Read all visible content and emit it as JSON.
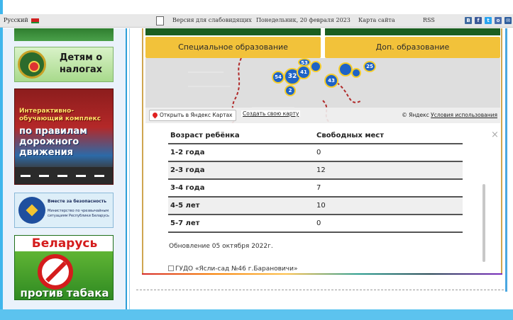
{
  "topbar": {
    "lang": "Русский",
    "low_vision": "Версия для слабовидящих",
    "date": "Понедельник, 20 февраля 2023",
    "sitemap": "Карта сайта",
    "rss": "RSS",
    "social": [
      {
        "icon": "vk-icon",
        "glyph": "B",
        "color": "#3f6aa0"
      },
      {
        "icon": "facebook-icon",
        "glyph": "f",
        "color": "#3b5998"
      },
      {
        "icon": "twitter-icon",
        "glyph": "t",
        "color": "#2aa3ef"
      },
      {
        "icon": "odnoklassniki-icon",
        "glyph": "o",
        "color": "#4a6fb0"
      },
      {
        "icon": "youtube-icon",
        "glyph": "✉",
        "color": "#2f5f9e"
      }
    ]
  },
  "sidebar": {
    "tax_banner": "Детям о налогах",
    "pdd_banner_line1": "Интерактивно-обучающий комплекс",
    "pdd_banner_line2": "по правилам дорожного движения",
    "safety_banner_line1": "Вместе за безопасность",
    "safety_banner_line2": "Министерство по чрезвычайным ситуациям Республики Беларусь",
    "tobacco_banner_line1": "Беларусь",
    "tobacco_banner_line2": "против табака"
  },
  "nav_buttons": {
    "special_education": "Специальное образование",
    "additional_education": "Доп. образование"
  },
  "map": {
    "open_in_yandex": "Открыть в Яндекс Картах",
    "create_map": "Создать свою карту",
    "copyright_prefix": "© Яндекс",
    "terms": "Условия использования",
    "clusters": [
      {
        "label": "53"
      },
      {
        "label": "25"
      },
      {
        "label": "54"
      },
      {
        "label": "32"
      },
      {
        "label": "41"
      },
      {
        "label": "43"
      },
      {
        "label": "2"
      }
    ]
  },
  "table": {
    "headers": {
      "age": "Возраст ребёнка",
      "free": "Свободных мест"
    },
    "rows": [
      {
        "age": "1-2 года",
        "free": "0"
      },
      {
        "age": "2-3 года",
        "free": "12"
      },
      {
        "age": "3-4 года",
        "free": "7"
      },
      {
        "age": "4-5 лет",
        "free": "10"
      },
      {
        "age": "5-7 лет",
        "free": "0"
      }
    ]
  },
  "updated": "Обновление 05 октября 2022г.",
  "broken_image_alt": "ГУДО «Ясли-сад №46 г.Барановичи»",
  "close_glyph": "×"
}
